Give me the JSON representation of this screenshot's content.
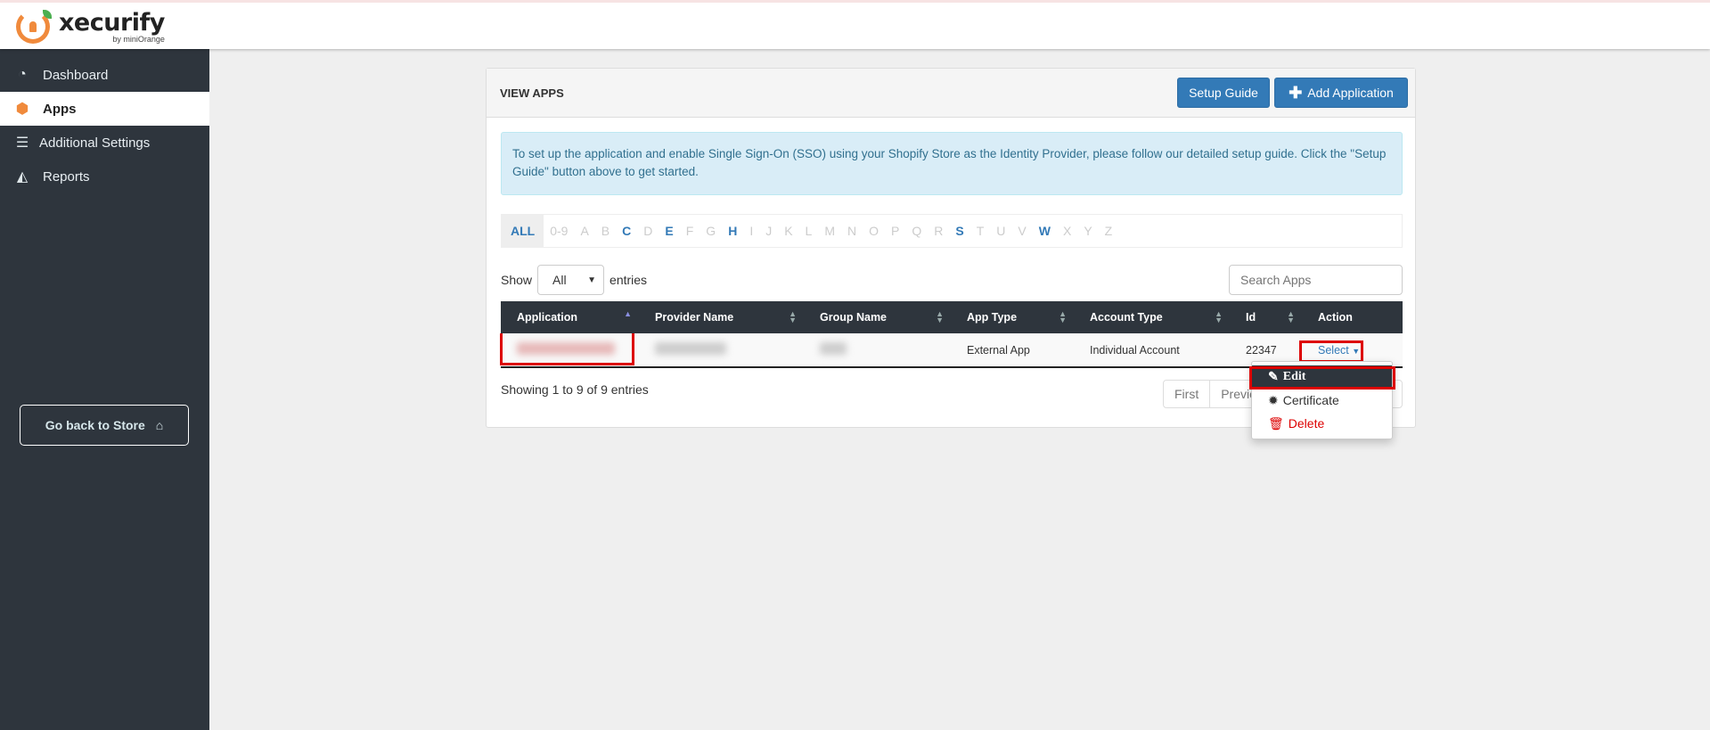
{
  "brand": {
    "name": "xecurify",
    "by": "by miniOrange"
  },
  "sidebar": {
    "items": [
      {
        "label": "Dashboard",
        "icon": "dashboard-icon"
      },
      {
        "label": "Apps",
        "icon": "cube-icon"
      },
      {
        "label": "Additional Settings",
        "icon": "database-icon"
      },
      {
        "label": "Reports",
        "icon": "chart-icon"
      }
    ],
    "go_back": "Go back to Store"
  },
  "panel": {
    "title": "VIEW APPS",
    "setup_guide": "Setup Guide",
    "add_application": "Add Application",
    "info": "To set up the application and enable Single Sign-On (SSO) using your Shopify Store as the Identity Provider, please follow our detailed setup guide. Click the \"Setup Guide\" button above to get started."
  },
  "alphabet": {
    "items": [
      "ALL",
      "0-9",
      "A",
      "B",
      "C",
      "D",
      "E",
      "F",
      "G",
      "H",
      "I",
      "J",
      "K",
      "L",
      "M",
      "N",
      "O",
      "P",
      "Q",
      "R",
      "S",
      "T",
      "U",
      "V",
      "W",
      "X",
      "Y",
      "Z"
    ],
    "active": [
      "ALL",
      "C",
      "E",
      "H",
      "S",
      "W"
    ]
  },
  "show": {
    "label": "Show",
    "value": "All",
    "suffix": "entries"
  },
  "search": {
    "placeholder": "Search Apps"
  },
  "table": {
    "columns": [
      "Application",
      "Provider Name",
      "Group Name",
      "App Type",
      "Account Type",
      "Id",
      "Action"
    ],
    "rows": [
      {
        "app_type": "External App",
        "account_type": "Individual Account",
        "id": "22347",
        "action": "Select"
      }
    ]
  },
  "showing": "Showing 1 to 9 of 9 entries",
  "pager": {
    "first": "First",
    "prev": "Previo"
  },
  "dropdown": {
    "edit": "Edit",
    "certificate": "Certificate",
    "delete": "Delete"
  },
  "colors": {
    "primary": "#337ab7",
    "sidebar": "#2e353d",
    "accent": "#f08a3c",
    "danger": "#d00000"
  }
}
